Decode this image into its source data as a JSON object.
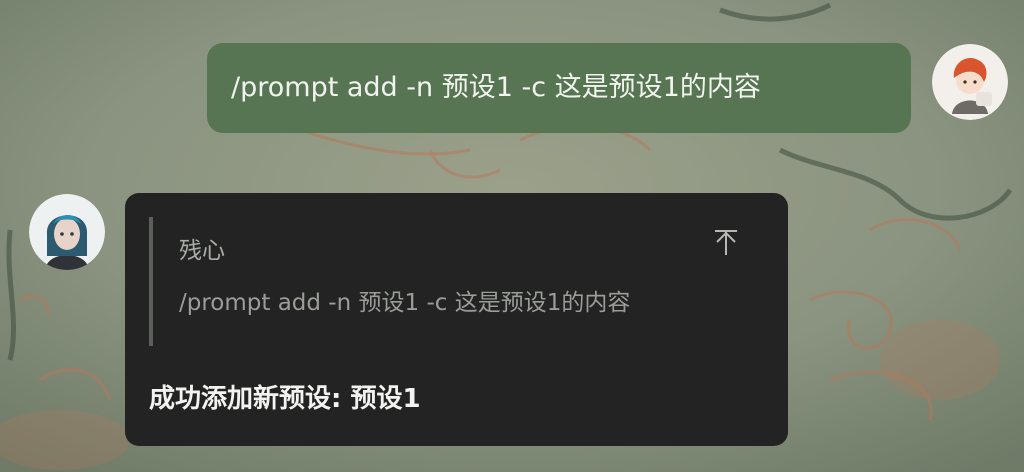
{
  "outgoing_message": {
    "text": "/prompt add -n 预设1 -c 这是预设1的内容",
    "bubble_color": "#577552"
  },
  "incoming_message": {
    "quote": {
      "author": "残心",
      "text": "/prompt add -n 预设1 -c 这是预设1的内容",
      "jump_icon": "jump-to-top-icon"
    },
    "reply": "成功添加新预设: 预设1",
    "bubble_color": "#222322"
  },
  "avatars": {
    "self": "user-avatar",
    "bot": "bot-avatar"
  },
  "colors": {
    "background": "#8a947c",
    "accent_swirl": "#b7785a"
  }
}
